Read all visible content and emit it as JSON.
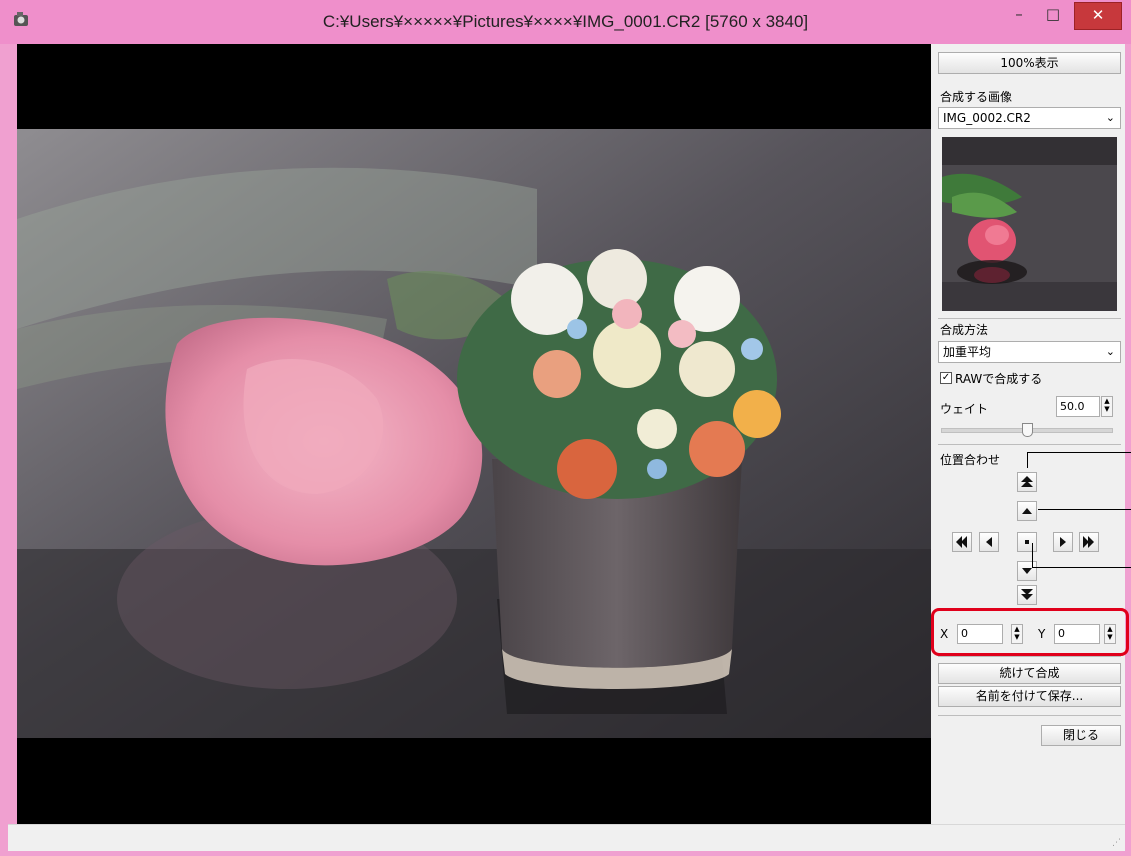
{
  "window": {
    "title": "C:¥Users¥×××××¥Pictures¥××××¥IMG_0001.CR2 [5760 x 3840]",
    "minimize_glyph": "–",
    "maximize_glyph": "□",
    "close_glyph": "✕"
  },
  "panel": {
    "view_100_button": "100%表示",
    "combine_image_label": "合成する画像",
    "combine_image_value": "IMG_0002.CR2",
    "method_label": "合成方法",
    "method_value": "加重平均",
    "raw_checkbox_label": "RAWで合成する",
    "raw_checked": true,
    "weight_label": "ウェイト",
    "weight_value": "50.0",
    "weight_slider_fraction": 0.5,
    "alignment_label": "位置合わせ",
    "x_label": "X",
    "x_value": "0",
    "y_label": "Y",
    "y_value": "0",
    "continue_button": "続けて合成",
    "save_as_button": "名前を付けて保存...",
    "close_button": "閉じる"
  },
  "icons": {
    "app": "app-icon",
    "chevron": "chevron-down-icon",
    "spin": "spinner-arrows-icon"
  },
  "colors": {
    "titlebar": "#ef8fcb",
    "close": "#c7383c",
    "highlight": "#e0001b"
  }
}
